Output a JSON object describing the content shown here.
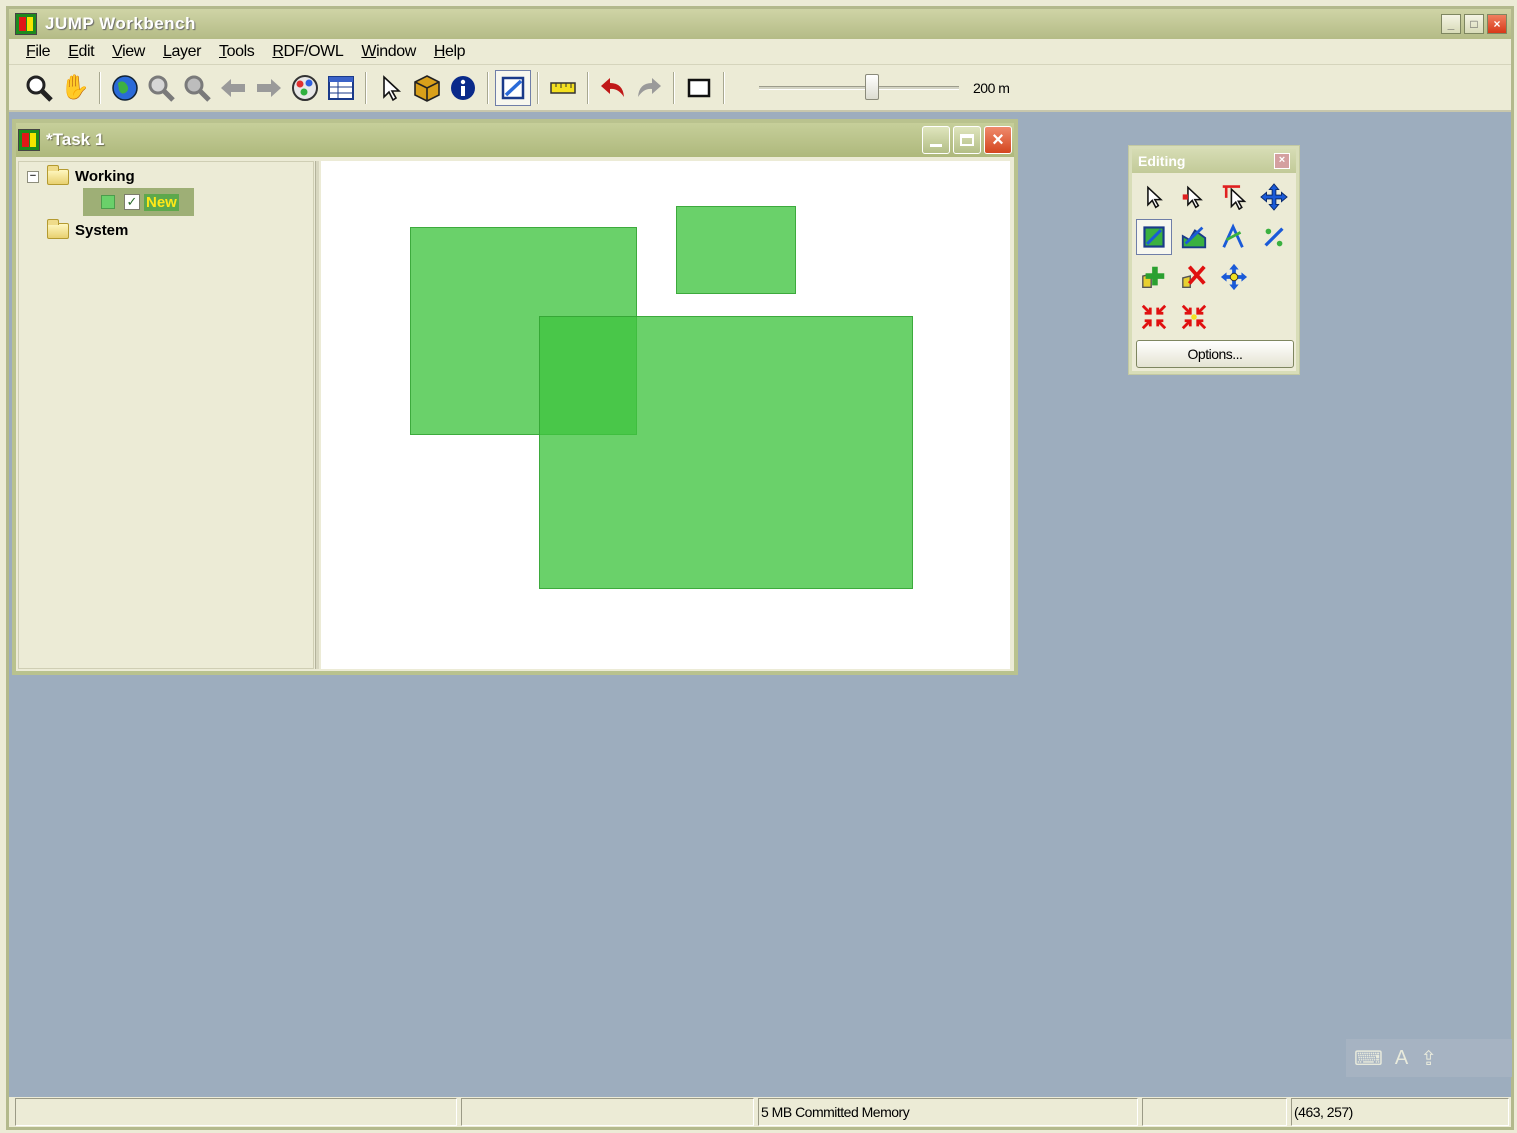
{
  "app": {
    "title": "JUMP Workbench"
  },
  "menu": [
    "File",
    "Edit",
    "View",
    "Layer",
    "Tools",
    "RDF/OWL",
    "Window",
    "Help"
  ],
  "toolbar": {
    "scale_label": "200 m",
    "icons": [
      "zoom-icon",
      "pan-hand-icon",
      "zoom-to-full-extent-icon",
      "zoom-in-icon",
      "zoom-out-icon",
      "zoom-previous-icon",
      "zoom-next-icon",
      "layer-color-icon",
      "attribute-table-icon",
      "select-arrow-icon",
      "feature-info-icon",
      "info-icon",
      "edit-toolbox-icon",
      "measure-icon",
      "undo-icon",
      "redo-icon",
      "fence-icon"
    ]
  },
  "task_window": {
    "title": "Task 1",
    "tree": {
      "categories": [
        {
          "name": "Working",
          "expanded": true,
          "layers": [
            {
              "name": "New",
              "checked": true,
              "color": "#6ad06a"
            }
          ]
        },
        {
          "name": "System",
          "expanded": false,
          "layers": []
        }
      ]
    },
    "map": {
      "fill_color": "#40c440"
    }
  },
  "editing_palette": {
    "title": "Editing",
    "options_label": "Options..."
  },
  "status": {
    "memory": "5 MB Committed Memory",
    "coordinates": "(463, 257)"
  },
  "colors": {
    "desktop": "#9dadbe",
    "window_title": "#b4bb86",
    "polygon": "#40c440"
  }
}
